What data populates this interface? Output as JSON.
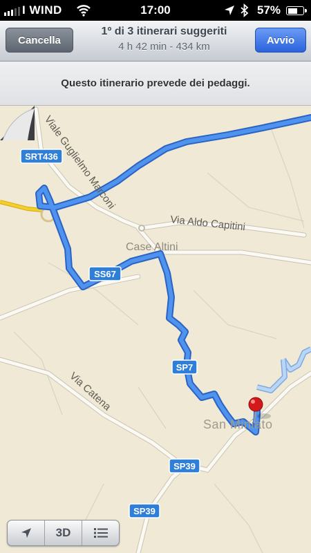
{
  "status_bar": {
    "carrier": "I WIND",
    "time": "17:00",
    "battery_percent": "57%",
    "signal_bars_filled": 3,
    "icons": [
      "signal-bars-icon",
      "wifi-icon",
      "location-arrow-icon",
      "bluetooth-icon",
      "battery-icon"
    ]
  },
  "nav_bar": {
    "cancel_label": "Cancella",
    "title": "1º di 3 itinerari suggeriti",
    "subtitle": "4 h 42 min - 434 km",
    "start_label": "Avvio"
  },
  "notice": {
    "text": "Questo itinerario prevede dei pedaggi."
  },
  "map": {
    "roads": {
      "viale_guglielmo_marconi": "Viale Guglielmo Marconi",
      "via_aldo_capitini": "Via Aldo Capitini",
      "via_catena": "Via Catena"
    },
    "places": {
      "case_altini": "Case Altini",
      "san_miniato": "San Miniato"
    },
    "shields": {
      "srt436": "SRT436",
      "ss67": "SS67",
      "sp7": "SP7",
      "sp39_upper": "SP39",
      "sp39_lower": "SP39"
    },
    "colors": {
      "background": "#efe9d6",
      "route": "#3d7fd9",
      "alt_route": "#9cc3f2",
      "shield": "#2f7fd8",
      "highway": "#f1c40f",
      "pin": "#e01b1b"
    }
  },
  "toolbar": {
    "locate_icon": "location-arrow-icon",
    "three_d_label": "3D",
    "list_icon": "list-icon"
  }
}
